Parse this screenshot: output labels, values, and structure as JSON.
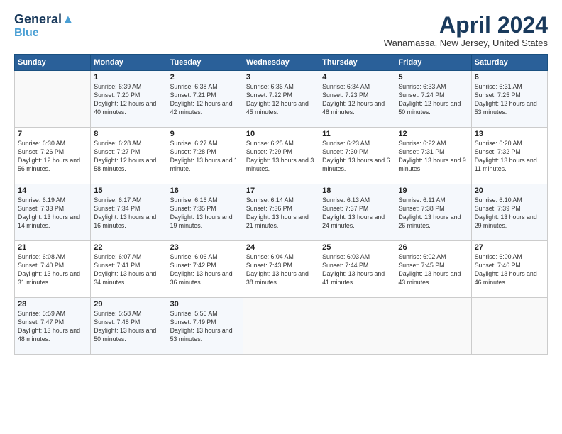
{
  "header": {
    "logo_line1": "General",
    "logo_line2": "Blue",
    "title": "April 2024",
    "location": "Wanamassa, New Jersey, United States"
  },
  "days_of_week": [
    "Sunday",
    "Monday",
    "Tuesday",
    "Wednesday",
    "Thursday",
    "Friday",
    "Saturday"
  ],
  "weeks": [
    [
      {
        "day": "",
        "sunrise": "",
        "sunset": "",
        "daylight": ""
      },
      {
        "day": "1",
        "sunrise": "Sunrise: 6:39 AM",
        "sunset": "Sunset: 7:20 PM",
        "daylight": "Daylight: 12 hours and 40 minutes."
      },
      {
        "day": "2",
        "sunrise": "Sunrise: 6:38 AM",
        "sunset": "Sunset: 7:21 PM",
        "daylight": "Daylight: 12 hours and 42 minutes."
      },
      {
        "day": "3",
        "sunrise": "Sunrise: 6:36 AM",
        "sunset": "Sunset: 7:22 PM",
        "daylight": "Daylight: 12 hours and 45 minutes."
      },
      {
        "day": "4",
        "sunrise": "Sunrise: 6:34 AM",
        "sunset": "Sunset: 7:23 PM",
        "daylight": "Daylight: 12 hours and 48 minutes."
      },
      {
        "day": "5",
        "sunrise": "Sunrise: 6:33 AM",
        "sunset": "Sunset: 7:24 PM",
        "daylight": "Daylight: 12 hours and 50 minutes."
      },
      {
        "day": "6",
        "sunrise": "Sunrise: 6:31 AM",
        "sunset": "Sunset: 7:25 PM",
        "daylight": "Daylight: 12 hours and 53 minutes."
      }
    ],
    [
      {
        "day": "7",
        "sunrise": "Sunrise: 6:30 AM",
        "sunset": "Sunset: 7:26 PM",
        "daylight": "Daylight: 12 hours and 56 minutes."
      },
      {
        "day": "8",
        "sunrise": "Sunrise: 6:28 AM",
        "sunset": "Sunset: 7:27 PM",
        "daylight": "Daylight: 12 hours and 58 minutes."
      },
      {
        "day": "9",
        "sunrise": "Sunrise: 6:27 AM",
        "sunset": "Sunset: 7:28 PM",
        "daylight": "Daylight: 13 hours and 1 minute."
      },
      {
        "day": "10",
        "sunrise": "Sunrise: 6:25 AM",
        "sunset": "Sunset: 7:29 PM",
        "daylight": "Daylight: 13 hours and 3 minutes."
      },
      {
        "day": "11",
        "sunrise": "Sunrise: 6:23 AM",
        "sunset": "Sunset: 7:30 PM",
        "daylight": "Daylight: 13 hours and 6 minutes."
      },
      {
        "day": "12",
        "sunrise": "Sunrise: 6:22 AM",
        "sunset": "Sunset: 7:31 PM",
        "daylight": "Daylight: 13 hours and 9 minutes."
      },
      {
        "day": "13",
        "sunrise": "Sunrise: 6:20 AM",
        "sunset": "Sunset: 7:32 PM",
        "daylight": "Daylight: 13 hours and 11 minutes."
      }
    ],
    [
      {
        "day": "14",
        "sunrise": "Sunrise: 6:19 AM",
        "sunset": "Sunset: 7:33 PM",
        "daylight": "Daylight: 13 hours and 14 minutes."
      },
      {
        "day": "15",
        "sunrise": "Sunrise: 6:17 AM",
        "sunset": "Sunset: 7:34 PM",
        "daylight": "Daylight: 13 hours and 16 minutes."
      },
      {
        "day": "16",
        "sunrise": "Sunrise: 6:16 AM",
        "sunset": "Sunset: 7:35 PM",
        "daylight": "Daylight: 13 hours and 19 minutes."
      },
      {
        "day": "17",
        "sunrise": "Sunrise: 6:14 AM",
        "sunset": "Sunset: 7:36 PM",
        "daylight": "Daylight: 13 hours and 21 minutes."
      },
      {
        "day": "18",
        "sunrise": "Sunrise: 6:13 AM",
        "sunset": "Sunset: 7:37 PM",
        "daylight": "Daylight: 13 hours and 24 minutes."
      },
      {
        "day": "19",
        "sunrise": "Sunrise: 6:11 AM",
        "sunset": "Sunset: 7:38 PM",
        "daylight": "Daylight: 13 hours and 26 minutes."
      },
      {
        "day": "20",
        "sunrise": "Sunrise: 6:10 AM",
        "sunset": "Sunset: 7:39 PM",
        "daylight": "Daylight: 13 hours and 29 minutes."
      }
    ],
    [
      {
        "day": "21",
        "sunrise": "Sunrise: 6:08 AM",
        "sunset": "Sunset: 7:40 PM",
        "daylight": "Daylight: 13 hours and 31 minutes."
      },
      {
        "day": "22",
        "sunrise": "Sunrise: 6:07 AM",
        "sunset": "Sunset: 7:41 PM",
        "daylight": "Daylight: 13 hours and 34 minutes."
      },
      {
        "day": "23",
        "sunrise": "Sunrise: 6:06 AM",
        "sunset": "Sunset: 7:42 PM",
        "daylight": "Daylight: 13 hours and 36 minutes."
      },
      {
        "day": "24",
        "sunrise": "Sunrise: 6:04 AM",
        "sunset": "Sunset: 7:43 PM",
        "daylight": "Daylight: 13 hours and 38 minutes."
      },
      {
        "day": "25",
        "sunrise": "Sunrise: 6:03 AM",
        "sunset": "Sunset: 7:44 PM",
        "daylight": "Daylight: 13 hours and 41 minutes."
      },
      {
        "day": "26",
        "sunrise": "Sunrise: 6:02 AM",
        "sunset": "Sunset: 7:45 PM",
        "daylight": "Daylight: 13 hours and 43 minutes."
      },
      {
        "day": "27",
        "sunrise": "Sunrise: 6:00 AM",
        "sunset": "Sunset: 7:46 PM",
        "daylight": "Daylight: 13 hours and 46 minutes."
      }
    ],
    [
      {
        "day": "28",
        "sunrise": "Sunrise: 5:59 AM",
        "sunset": "Sunset: 7:47 PM",
        "daylight": "Daylight: 13 hours and 48 minutes."
      },
      {
        "day": "29",
        "sunrise": "Sunrise: 5:58 AM",
        "sunset": "Sunset: 7:48 PM",
        "daylight": "Daylight: 13 hours and 50 minutes."
      },
      {
        "day": "30",
        "sunrise": "Sunrise: 5:56 AM",
        "sunset": "Sunset: 7:49 PM",
        "daylight": "Daylight: 13 hours and 53 minutes."
      },
      {
        "day": "",
        "sunrise": "",
        "sunset": "",
        "daylight": ""
      },
      {
        "day": "",
        "sunrise": "",
        "sunset": "",
        "daylight": ""
      },
      {
        "day": "",
        "sunrise": "",
        "sunset": "",
        "daylight": ""
      },
      {
        "day": "",
        "sunrise": "",
        "sunset": "",
        "daylight": ""
      }
    ]
  ]
}
